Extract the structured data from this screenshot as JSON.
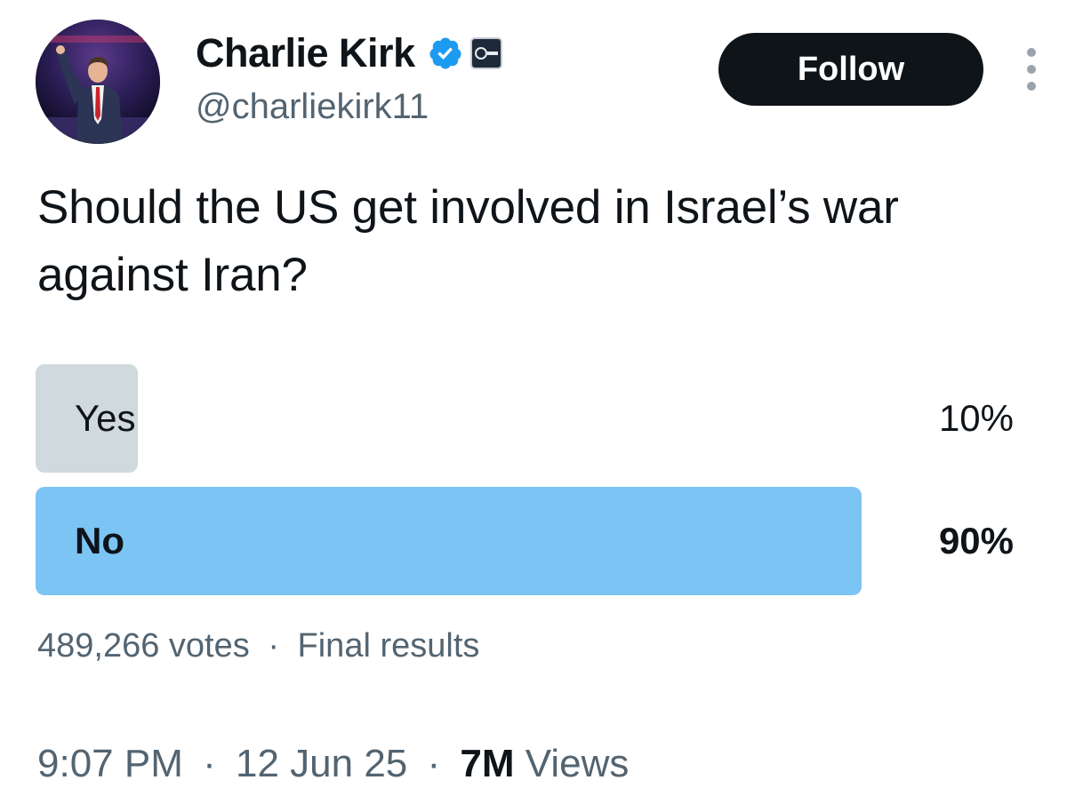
{
  "author": {
    "display_name": "Charlie Kirk",
    "handle": "@charliekirk11",
    "verified": true,
    "affiliate_badge": "organization-badge"
  },
  "follow_label": "Follow",
  "tweet_text": "Should the US get involved in Israel’s war against Iran?",
  "poll": {
    "options": [
      {
        "label": "Yes",
        "percent_text": "10%",
        "percent": 10,
        "winner": false
      },
      {
        "label": "No",
        "percent_text": "90%",
        "percent": 90,
        "winner": true
      }
    ],
    "votes": "489,266 votes",
    "separator": "·",
    "status": "Final results"
  },
  "meta": {
    "time": "9:07 PM",
    "date": "12 Jun 25",
    "separator": "·",
    "views_count": "7M",
    "views_label": "Views"
  },
  "colors": {
    "winner_bar": "#7cc4f4",
    "loser_bar": "#cfd9de",
    "follow_bg": "#0f1419",
    "verified": "#1d9bf0",
    "secondary_text": "#536471"
  }
}
